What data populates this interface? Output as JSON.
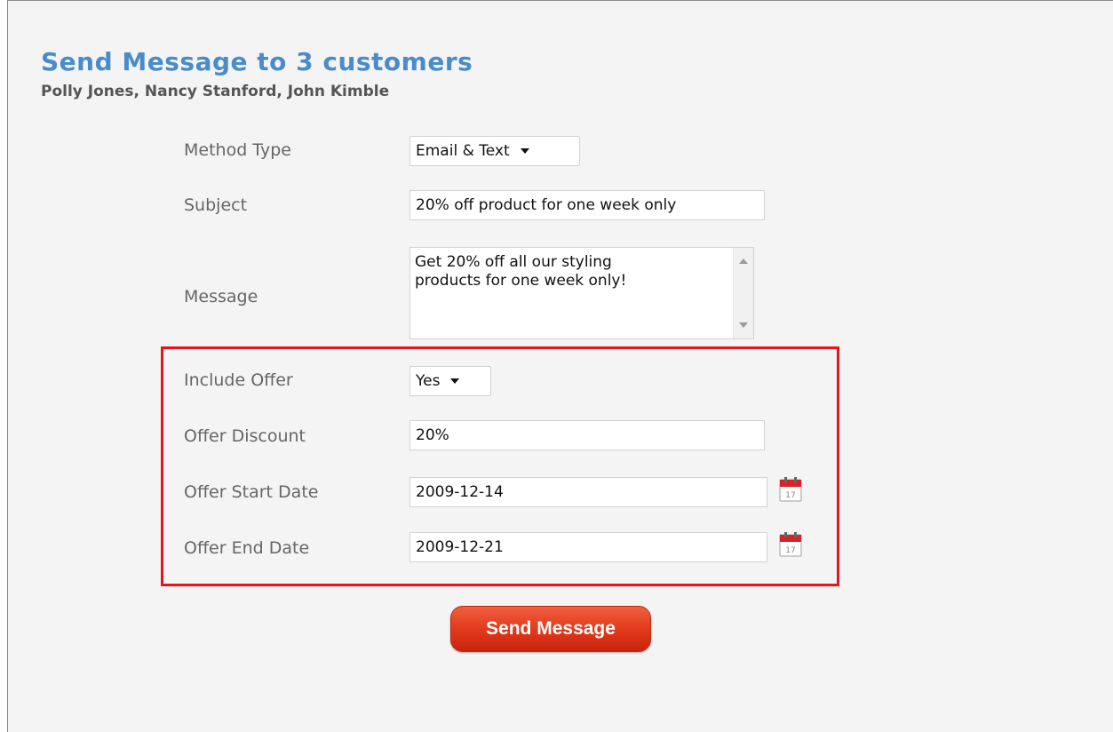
{
  "header": {
    "title": "Send Message to 3 customers",
    "recipients": "Polly Jones, Nancy Stanford, John Kimble"
  },
  "form": {
    "method_type": {
      "label": "Method Type",
      "value": "Email & Text"
    },
    "subject": {
      "label": "Subject",
      "value": "20% off product for one week only"
    },
    "message": {
      "label": "Message",
      "value": "Get 20% off all our styling\nproducts for one week only!"
    },
    "offer": {
      "include_offer": {
        "label": "Include Offer",
        "value": "Yes"
      },
      "discount": {
        "label": "Offer Discount",
        "value": "20%"
      },
      "start_date": {
        "label": "Offer Start Date",
        "value": "2009-12-14"
      },
      "end_date": {
        "label": "Offer End Date",
        "value": "2009-12-21"
      },
      "calendar_icon_text": "17",
      "highlight_color": "#e8141c"
    },
    "send_button": "Send Message"
  },
  "colors": {
    "title": "#4a8cc9",
    "button": "#e23a1c"
  },
  "icons": {
    "dropdown": "chevron-down-icon",
    "calendar": "calendar-icon",
    "scroll_up": "scroll-up-icon",
    "scroll_down": "scroll-down-icon"
  }
}
